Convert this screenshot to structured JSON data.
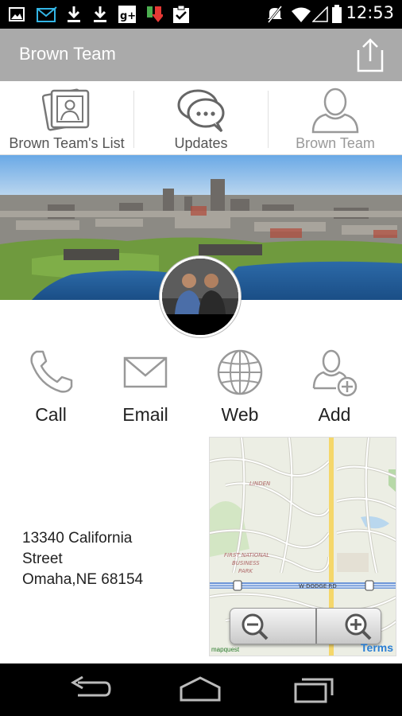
{
  "status_bar": {
    "clock": "12:53",
    "icons": [
      "image-icon",
      "mail-icon",
      "download-icon",
      "download-icon",
      "google-plus-icon",
      "app-download-icon",
      "clipboard-check-icon",
      "mute-icon",
      "wifi-icon",
      "signal-icon",
      "battery-icon"
    ]
  },
  "action_bar": {
    "title": "Brown Team",
    "share_icon": "share-icon",
    "background": "#aaaaaa"
  },
  "tabs": [
    {
      "label": "Brown Team's List",
      "icon": "photo-album-icon"
    },
    {
      "label": "Updates",
      "icon": "chat-bubbles-icon"
    },
    {
      "label": "Brown Team",
      "icon": "person-icon"
    }
  ],
  "actions": [
    {
      "label": "Call",
      "icon": "phone-icon"
    },
    {
      "label": "Email",
      "icon": "envelope-icon"
    },
    {
      "label": "Web",
      "icon": "globe-icon"
    },
    {
      "label": "Add",
      "icon": "add-contact-icon"
    }
  ],
  "address": {
    "line1": "13340 California",
    "line2": "Street",
    "line3": "Omaha,NE 68154"
  },
  "map": {
    "terms": "Terms",
    "attribution": "mapquest",
    "labels": {
      "linden": "LINDEN",
      "business_park_1": "FIRST NATIONAL",
      "business_park_2": "BUSINESS",
      "business_park_3": "PARK",
      "dodge": "W DODGE RD"
    }
  },
  "nav_bar": {
    "icons": [
      "back-icon",
      "home-icon",
      "recent-apps-icon"
    ]
  }
}
